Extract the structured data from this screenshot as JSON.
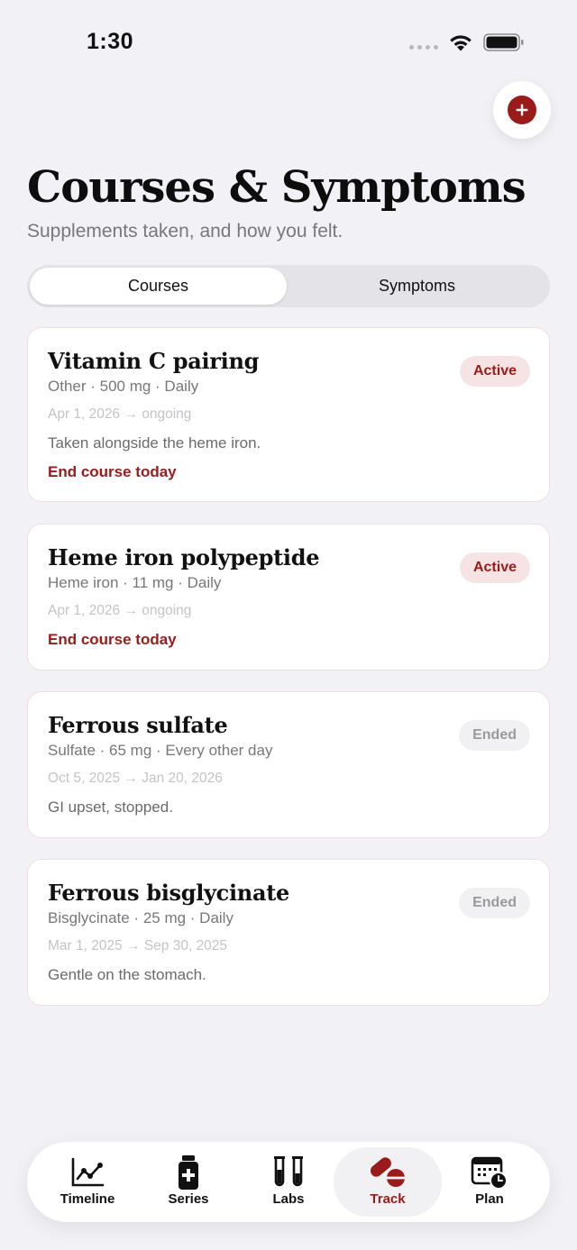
{
  "status_bar": {
    "time": "1:30"
  },
  "header": {
    "title": "Courses & Symptoms",
    "subtitle": "Supplements taken, and how you felt."
  },
  "segments": [
    {
      "label": "Courses",
      "selected": true
    },
    {
      "label": "Symptoms",
      "selected": false
    }
  ],
  "cards": [
    {
      "title": "Vitamin C pairing",
      "subtitle": "Other · 500 mg · Daily",
      "dates": "Apr 1, 2026 → ongoing",
      "note": "Taken alongside the heme iron.",
      "action": "End course today",
      "status": "Active"
    },
    {
      "title": "Heme iron polypeptide",
      "subtitle": "Heme iron · 11 mg · Daily",
      "dates": "Apr 1, 2026 → ongoing",
      "note": "",
      "action": "End course today",
      "status": "Active"
    },
    {
      "title": "Ferrous sulfate",
      "subtitle": "Sulfate · 65 mg · Every other day",
      "dates": "Oct 5, 2025 → Jan 20, 2026",
      "note": "GI upset, stopped.",
      "action": "",
      "status": "Ended"
    },
    {
      "title": "Ferrous bisglycinate",
      "subtitle": "Bisglycinate · 25 mg · Daily",
      "dates": "Mar 1, 2025 → Sep 30, 2025",
      "note": "Gentle on the stomach.",
      "action": "",
      "status": "Ended"
    }
  ],
  "tab_bar": {
    "items": [
      {
        "label": "Timeline",
        "icon": "chart-line-icon",
        "selected": false
      },
      {
        "label": "Series",
        "icon": "medicine-bottle-icon",
        "selected": false
      },
      {
        "label": "Labs",
        "icon": "test-tubes-icon",
        "selected": false
      },
      {
        "label": "Track",
        "icon": "pills-icon",
        "selected": true
      },
      {
        "label": "Plan",
        "icon": "calendar-clock-icon",
        "selected": false
      }
    ]
  },
  "colors": {
    "accent": "#9b1b1b",
    "background": "#f2f2f6",
    "active_badge_bg": "#f6e4e4",
    "ended_badge_bg": "#f1f1f3"
  }
}
